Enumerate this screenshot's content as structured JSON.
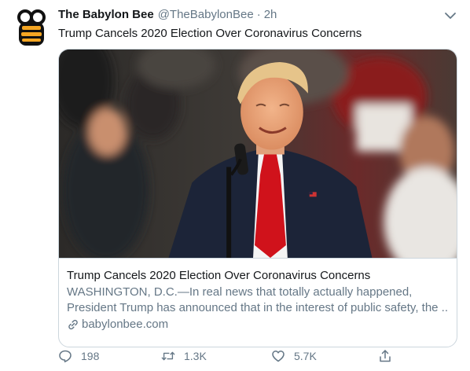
{
  "tweet": {
    "display_name": "The Babylon Bee",
    "handle": "@TheBabylonBee",
    "separator": "·",
    "time": "2h",
    "text": "Trump Cancels 2020 Election Over Coronavirus Concerns",
    "avatar_icon": "bee-logo-icon",
    "menu_icon": "chevron-down-icon"
  },
  "card": {
    "title": "Trump Cancels 2020 Election Over Coronavirus Concerns",
    "description_line1": "WASHINGTON, D.C.—In real news that totally actually happened,",
    "description_line2": "President Trump has announced that in the interest of public safety, the ...",
    "domain": "babylonbee.com",
    "domain_icon": "link-icon",
    "image_subject": "speaker-at-microphone-photo"
  },
  "actions": {
    "reply": {
      "icon": "reply-icon",
      "count": "198"
    },
    "retweet": {
      "icon": "retweet-icon",
      "count": "1.3K"
    },
    "like": {
      "icon": "heart-icon",
      "count": "5.7K"
    },
    "share": {
      "icon": "share-icon"
    }
  },
  "colors": {
    "primary_text": "#14171a",
    "secondary_text": "#657786",
    "border": "#ccd6dd",
    "brand": "#f5a623"
  }
}
